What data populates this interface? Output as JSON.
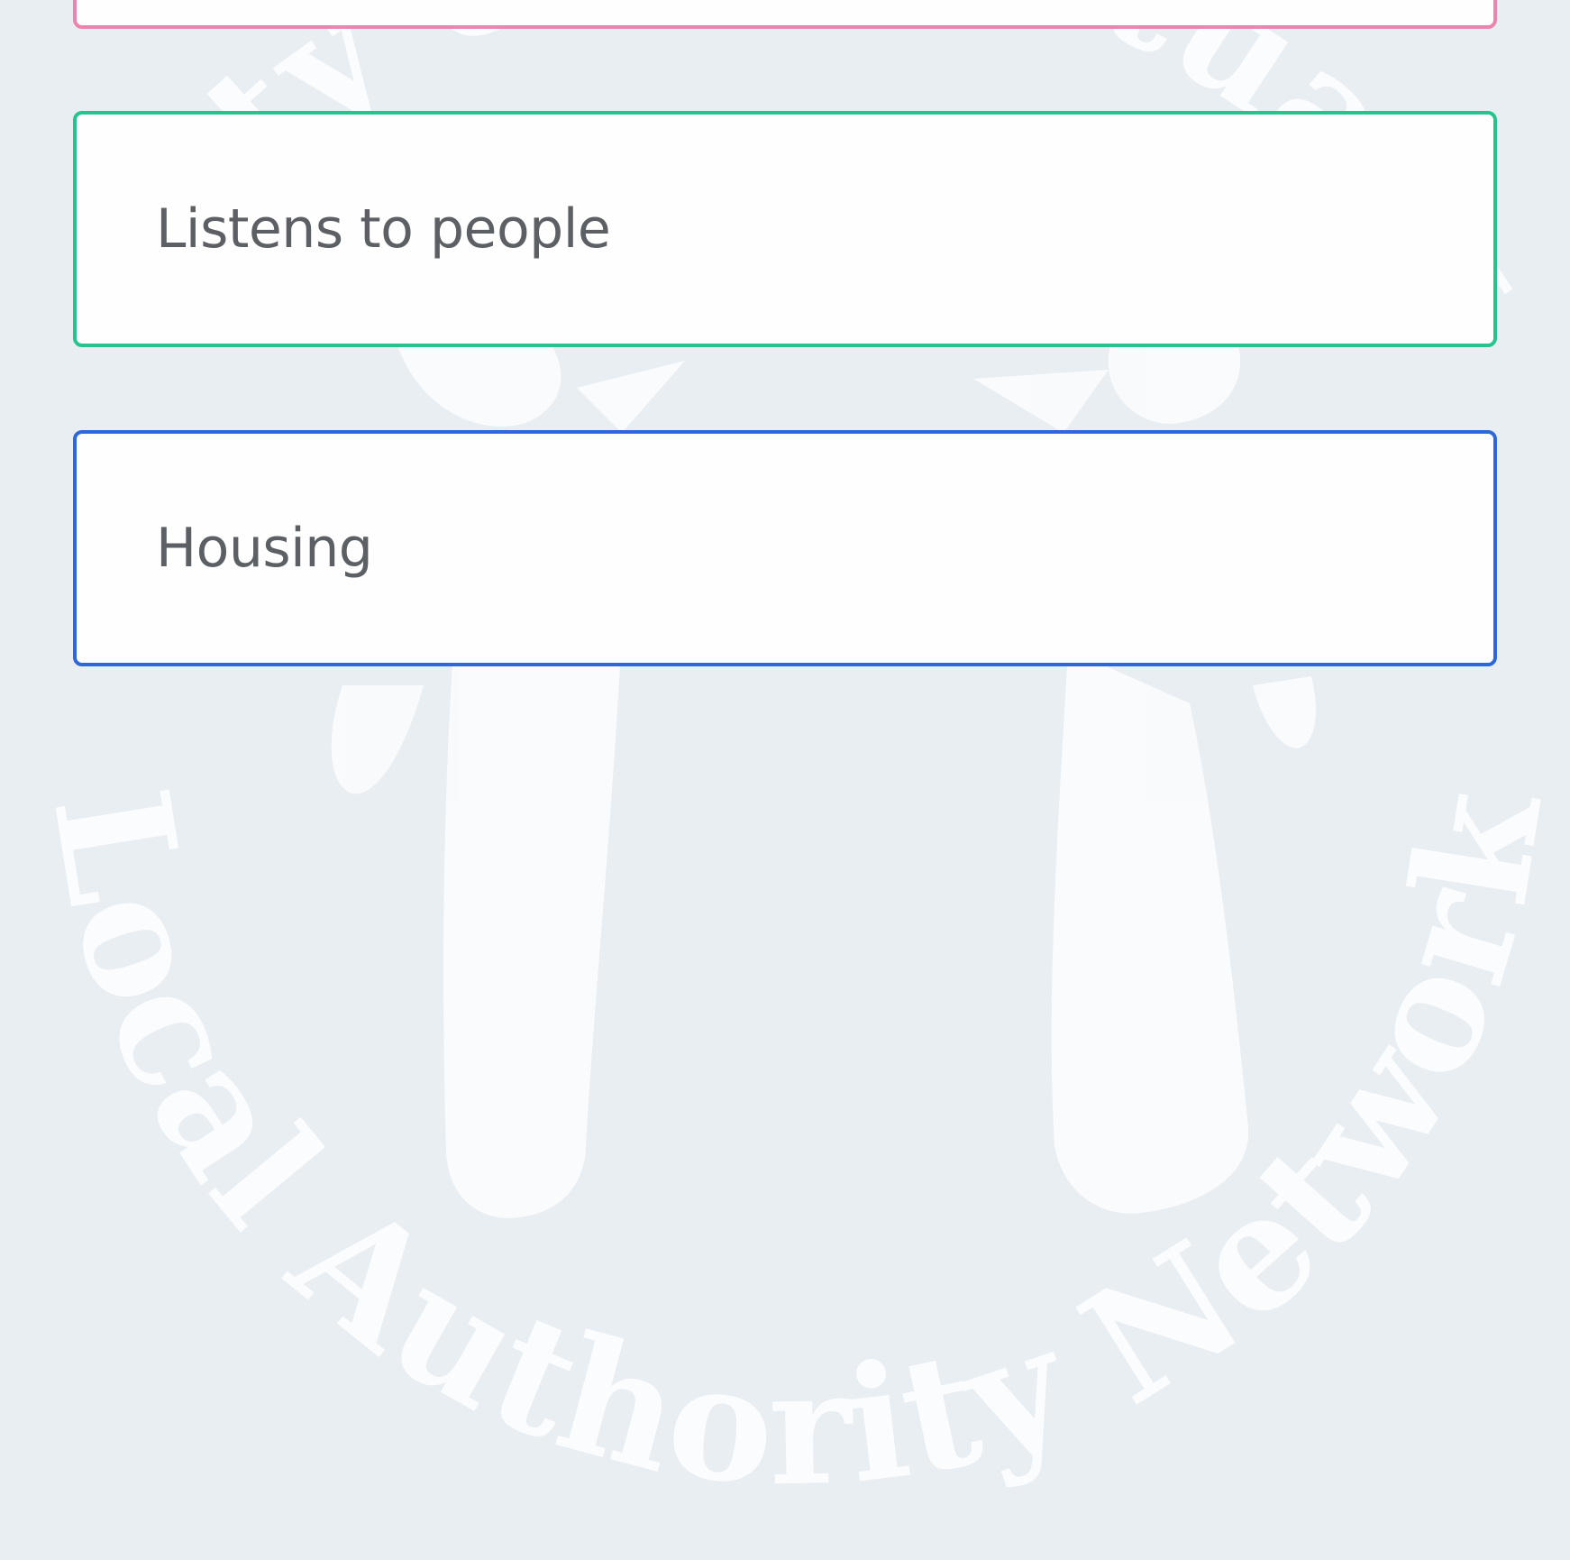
{
  "options": [
    {
      "label": "",
      "color": "#ec84ae"
    },
    {
      "label": "Listens to people",
      "color": "#23c48c"
    },
    {
      "label": "Housing",
      "color": "#2a66d9"
    }
  ],
  "watermark": {
    "text": "Local Authority Network",
    "partial_top_text": "City of Sanctuary",
    "color": "#ffffff",
    "background": "#e9eef2"
  }
}
